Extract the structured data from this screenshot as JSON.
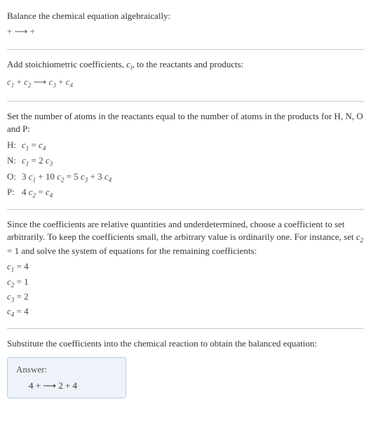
{
  "section1": {
    "heading": "Balance the chemical equation algebraically:",
    "equation": " +  ⟶  + "
  },
  "section2": {
    "heading_p1": "Add stoichiometric coefficients, ",
    "heading_ci_c": "c",
    "heading_ci_i": "i",
    "heading_p2": ", to the reactants and products:",
    "c1": "c",
    "s1": "1",
    "plus1": "  + ",
    "c2": "c",
    "s2": "2",
    "arrow": "   ⟶ ",
    "c3": "c",
    "s3": "3",
    "plus2": "  + ",
    "c4": "c",
    "s4": "4"
  },
  "section3": {
    "heading": "Set the number of atoms in the reactants equal to the number of atoms in the products for H, N, O and P:",
    "rows": [
      {
        "label": "H:",
        "lhs_c": "c",
        "lhs_s": "1",
        "eq": " = ",
        "rhs_c": "c",
        "rhs_s": "4",
        "full_text": ""
      },
      {
        "label": "N:",
        "lhs_c": "c",
        "lhs_s": "1",
        "eq": " = 2 ",
        "rhs_c": "c",
        "rhs_s": "3",
        "full_text": ""
      },
      {
        "label": "O:",
        "text_pre": "3 ",
        "c1": "c",
        "s1": "1",
        "mid1": " + 10 ",
        "c2": "c",
        "s2": "2",
        "mid2": " = 5 ",
        "c3": "c",
        "s3": "3",
        "mid3": " + 3 ",
        "c4": "c",
        "s4": "4"
      },
      {
        "label": "P:",
        "text_pre": "4 ",
        "c1": "c",
        "s1": "2",
        "mid1": " = ",
        "c2": "c",
        "s2": "4"
      }
    ]
  },
  "section4": {
    "heading_p1": "Since the coefficients are relative quantities and underdetermined, choose a coefficient to set arbitrarily. To keep the coefficients small, the arbitrary value is ordinarily one. For instance, set ",
    "heading_c": "c",
    "heading_s": "2",
    "heading_p2": " = 1 and solve the system of equations for the remaining coefficients:",
    "lines": [
      {
        "c": "c",
        "s": "1",
        "val": " = 4"
      },
      {
        "c": "c",
        "s": "2",
        "val": " = 1"
      },
      {
        "c": "c",
        "s": "3",
        "val": " = 2"
      },
      {
        "c": "c",
        "s": "4",
        "val": " = 4"
      }
    ]
  },
  "section5": {
    "heading": "Substitute the coefficients into the chemical reaction to obtain the balanced equation:",
    "answer_label": "Answer:",
    "answer_content": "4  +   ⟶ 2  + 4 "
  },
  "chart_data": {
    "type": "table",
    "title": "Balanced chemical equation coefficients",
    "coefficients": {
      "c1": 4,
      "c2": 1,
      "c3": 2,
      "c4": 4
    },
    "atom_balance": [
      {
        "element": "H",
        "equation": "c1 = c4"
      },
      {
        "element": "N",
        "equation": "c1 = 2 c3"
      },
      {
        "element": "O",
        "equation": "3 c1 + 10 c2 = 5 c3 + 3 c4"
      },
      {
        "element": "P",
        "equation": "4 c2 = c4"
      }
    ],
    "balanced_equation": "4 + ⟶ 2 + 4"
  }
}
